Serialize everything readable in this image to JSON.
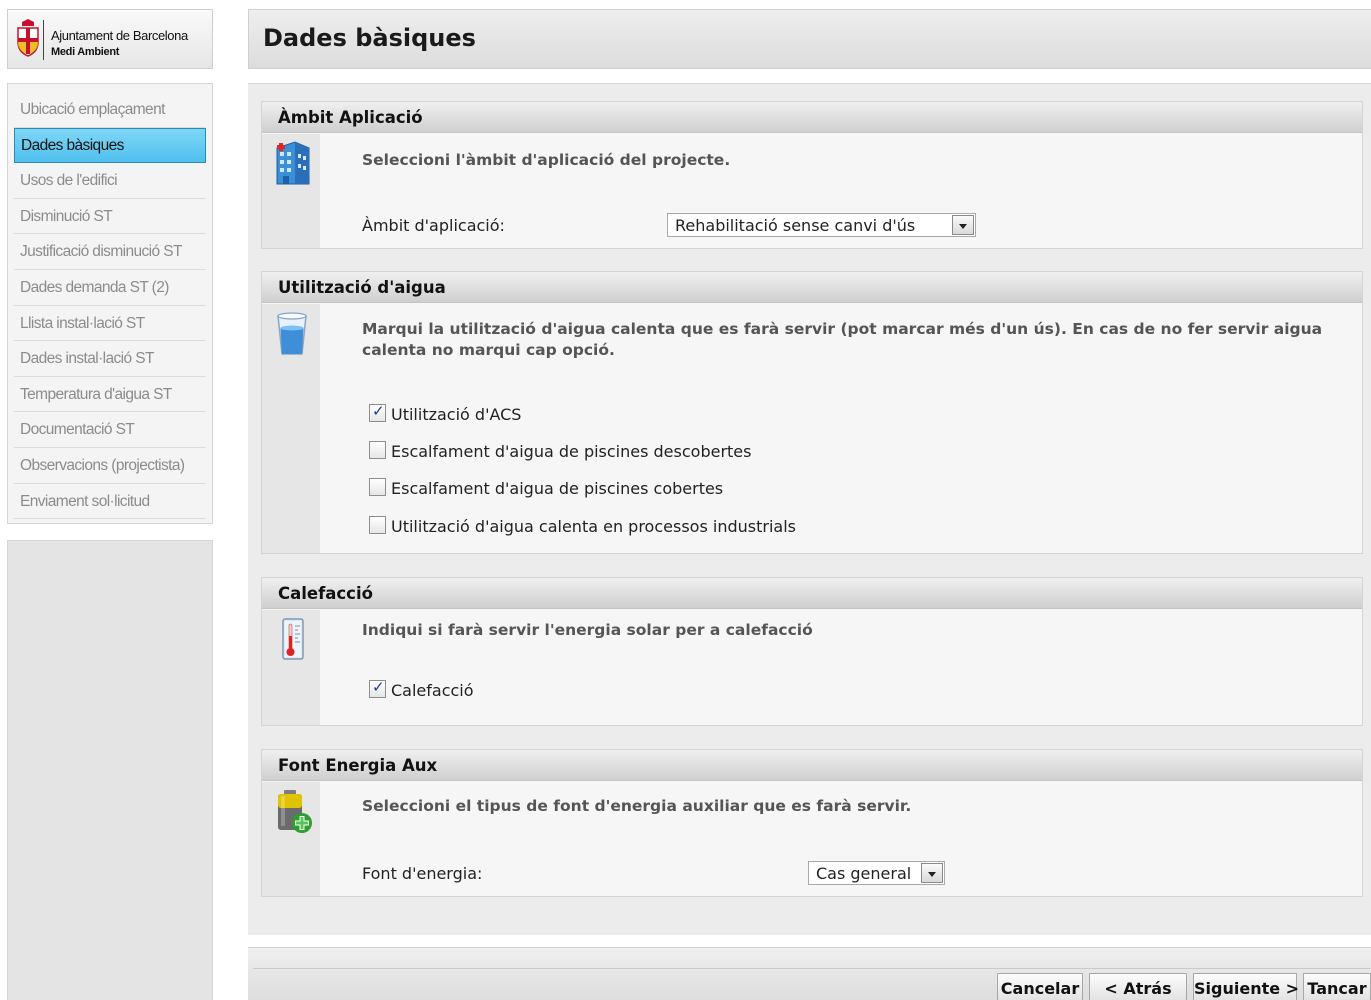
{
  "brand": {
    "organization": "Ajuntament de Barcelona",
    "department": "Medi Ambient",
    "accent_color": "#c8102e"
  },
  "sidebar": {
    "items": [
      {
        "label": "Ubicació emplaçament",
        "active": false
      },
      {
        "label": "Dades bàsiques",
        "active": true
      },
      {
        "label": "Usos de l'edifici",
        "active": false
      },
      {
        "label": "Disminució ST",
        "active": false
      },
      {
        "label": "Justificació disminució ST",
        "active": false
      },
      {
        "label": "Dades demanda ST (2)",
        "active": false
      },
      {
        "label": "Llista instal·lació ST",
        "active": false
      },
      {
        "label": "Dades instal·lació ST",
        "active": false
      },
      {
        "label": "Temperatura d'aigua ST",
        "active": false
      },
      {
        "label": "Documentació ST",
        "active": false
      },
      {
        "label": "Observacions (projectista)",
        "active": false
      },
      {
        "label": "Enviament sol·licitud",
        "active": false
      }
    ],
    "active_color": "#4fc0ee"
  },
  "page": {
    "title": "Dades bàsiques"
  },
  "sections": {
    "ambit": {
      "title": "Àmbit Aplicació",
      "icon": "building-icon",
      "description": "Seleccioni l'àmbit d'aplicació del projecte.",
      "field_label": "Àmbit d'aplicació:",
      "select_value": "Rehabilitació sense canvi d'ús"
    },
    "aigua": {
      "title": "Utilització d'aigua",
      "icon": "water-glass-icon",
      "description": "Marqui la utilització d'aigua calenta que es farà servir (pot marcar més d'un ús). En cas de no fer servir aigua calenta no marqui cap opció.",
      "options": [
        {
          "label": "Utilització d'ACS",
          "checked": true
        },
        {
          "label": "Escalfament d'aigua de piscines descobertes",
          "checked": false
        },
        {
          "label": "Escalfament d'aigua de piscines cobertes",
          "checked": false
        },
        {
          "label": "Utilització d'aigua calenta en processos industrials",
          "checked": false
        }
      ]
    },
    "calefaccio": {
      "title": "Calefacció",
      "icon": "thermometer-icon",
      "description": "Indiqui si farà servir l'energia solar per a calefacció",
      "option": {
        "label": "Calefacció",
        "checked": true
      }
    },
    "font": {
      "title": "Font Energia Aux",
      "icon": "battery-add-icon",
      "description": "Seleccioni el tipus de font d'energia auxiliar que es farà servir.",
      "field_label": "Font d'energia:",
      "select_value": "Cas general"
    }
  },
  "footer": {
    "cancel_label": "Cancelar",
    "back_label": "< Atrás",
    "next_label": "Siguiente >",
    "close_label": "Tancar"
  }
}
